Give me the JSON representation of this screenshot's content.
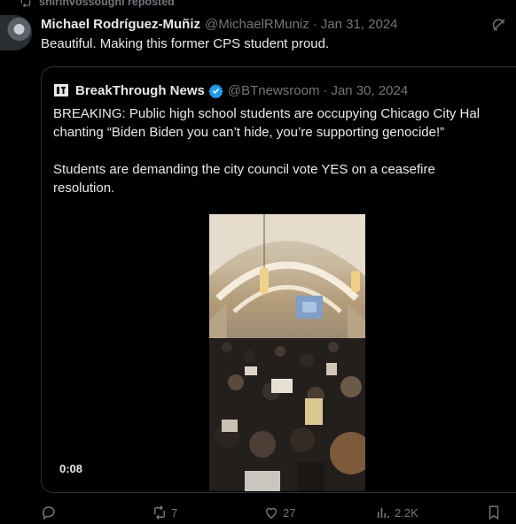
{
  "repost": {
    "label": "shirinvossoughi reposted"
  },
  "tweet": {
    "author_name": "Michael Rodríguez-Muñiz",
    "handle": "@MichaelRMuniz",
    "separator": "·",
    "date": "Jan 31, 2024",
    "text": "Beautiful. Making this former CPS student proud."
  },
  "quote": {
    "author_name": "BreakThrough News",
    "handle": "@BTnewsroom",
    "separator": "·",
    "date": "Jan 30, 2024",
    "line1": "BREAKING: Public high school students are occupying Chicago City Hal",
    "line2": "chanting “Biden Biden you can’t hide, you’re supporting genocide!”",
    "line3": "Students are demanding the city council vote YES on a ceasefire",
    "line4": "resolution.",
    "video_duration": "0:08"
  },
  "actions": {
    "replies": "",
    "reposts": "7",
    "likes": "27",
    "views": "2.2K"
  },
  "colors": {
    "background": "#000000",
    "text": "#e7e9ea",
    "muted": "#71767b",
    "verified": "#1d9bf0",
    "border": "#2f3336"
  }
}
